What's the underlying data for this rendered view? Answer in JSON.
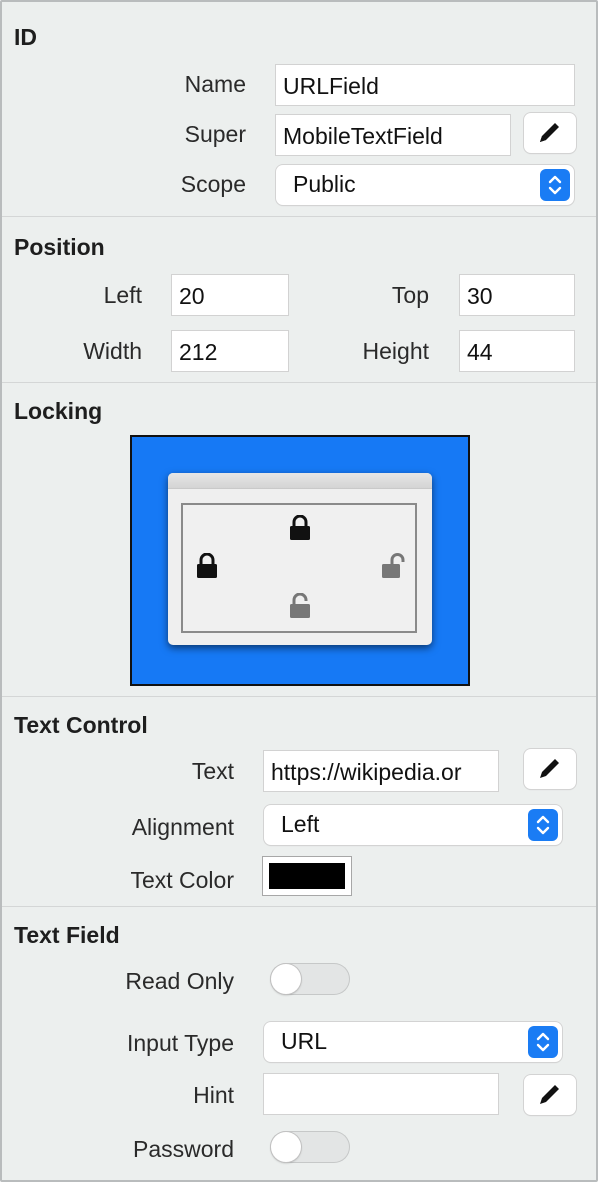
{
  "sections": {
    "id": {
      "title": "ID",
      "name_label": "Name",
      "name_value": "URLField",
      "super_label": "Super",
      "super_value": "MobileTextField",
      "scope_label": "Scope",
      "scope_value": "Public"
    },
    "position": {
      "title": "Position",
      "left_label": "Left",
      "left_value": "20",
      "top_label": "Top",
      "top_value": "30",
      "width_label": "Width",
      "width_value": "212",
      "height_label": "Height",
      "height_value": "44"
    },
    "locking": {
      "title": "Locking",
      "locks": {
        "top": "locked",
        "left": "locked",
        "right": "unlocked",
        "bottom": "unlocked"
      }
    },
    "text_control": {
      "title": "Text Control",
      "text_label": "Text",
      "text_value": "https://wikipedia.or",
      "alignment_label": "Alignment",
      "alignment_value": "Left",
      "text_color_label": "Text Color",
      "text_color_value": "#000000"
    },
    "text_field": {
      "title": "Text Field",
      "read_only_label": "Read Only",
      "read_only_on": false,
      "input_type_label": "Input Type",
      "input_type_value": "URL",
      "hint_label": "Hint",
      "hint_value": "",
      "password_label": "Password",
      "password_on": false
    }
  },
  "colors": {
    "panel_bg": "#ecefee",
    "accent": "#1a7cf4",
    "locking_bg": "#1679f5"
  },
  "icons": {
    "edit": "pencil-icon",
    "popup": "up-down-chevron-icon",
    "locked": "lock-closed-icon",
    "unlocked": "lock-open-icon"
  }
}
